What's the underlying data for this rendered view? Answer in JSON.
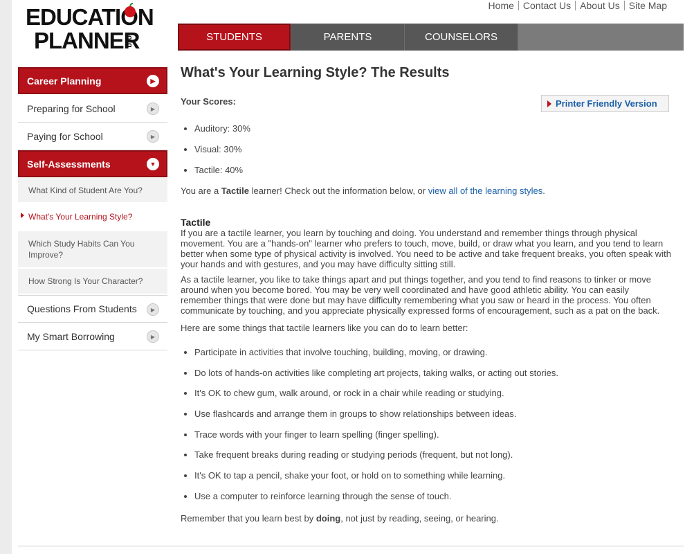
{
  "logo": {
    "line1": "EDUCATION",
    "line2": "PLANNER",
    "suffix": ".org",
    "sm": "SM"
  },
  "top_links": [
    "Home",
    "Contact Us",
    "About Us",
    "Site Map"
  ],
  "nav": {
    "tabs": [
      "STUDENTS",
      "PARENTS",
      "COUNSELORS"
    ],
    "active": "STUDENTS"
  },
  "sidebar": {
    "items": [
      {
        "label": "Career Planning",
        "style": "red"
      },
      {
        "label": "Preparing for School",
        "style": "normal"
      },
      {
        "label": "Paying for School",
        "style": "normal"
      },
      {
        "label": "Self-Assessments",
        "style": "red-expanded"
      }
    ],
    "sub_items": [
      "What Kind of Student Are You?",
      "What's Your Learning Style?",
      "Which Study Habits Can You Improve?",
      "How Strong Is Your Character?"
    ],
    "active_sub": "What's Your Learning Style?",
    "bottom_items": [
      "Questions From Students",
      "My Smart Borrowing"
    ]
  },
  "main": {
    "title": "What's Your Learning Style? The Results",
    "scores_label": "Your Scores:",
    "printer_label": "Printer Friendly Version",
    "scores": [
      "Auditory: 30%",
      "Visual: 30%",
      "Tactile: 40%"
    ],
    "result_prefix": "You are a ",
    "result_style": "Tactile",
    "result_middle": " learner! Check out the information below, or ",
    "result_link": "view all of the learning styles",
    "result_end": ".",
    "section_title": "Tactile",
    "paragraphs": [
      "If you are a tactile learner, you learn by touching and doing. You understand and remember things through physical movement. You are a \"hands-on\" learner who prefers to touch, move, build, or draw what you learn, and you tend to learn better when some type of physical activity is involved. You need to be active and take frequent breaks, you often speak with your hands and with gestures, and you may have difficulty sitting still.",
      "As a tactile learner, you like to take things apart and put things together, and you tend to find reasons to tinker or move around when you become bored. You may be very well coordinated and have good athletic ability. You can easily remember things that were done but may have difficulty remembering what you saw or heard in the process. You often communicate by touching, and you appreciate physically expressed forms of encouragement, such as a pat on the back."
    ],
    "tips_intro": "Here are some things that tactile learners like you can do to learn better:",
    "tips": [
      "Participate in activities that involve touching, building, moving, or drawing.",
      "Do lots of hands-on activities like completing art projects, taking walks, or acting out stories.",
      "It's OK to chew gum, walk around, or rock in a chair while reading or studying.",
      "Use flashcards and arrange them in groups to show relationships between ideas.",
      "Trace words with your finger to learn spelling (finger spelling).",
      "Take frequent breaks during reading or studying periods (frequent, but not long).",
      "It's OK to tap a pencil, shake your foot, or hold on to something while learning.",
      "Use a computer to reinforce learning through the sense of touch."
    ],
    "remember_prefix": "Remember that you learn best by ",
    "remember_bold": "doing",
    "remember_end": ", not just by reading, seeing, or hearing."
  },
  "colors": {
    "brand_red": "#b5121b",
    "link_blue": "#1a5fa8",
    "nav_gray": "#575757"
  }
}
